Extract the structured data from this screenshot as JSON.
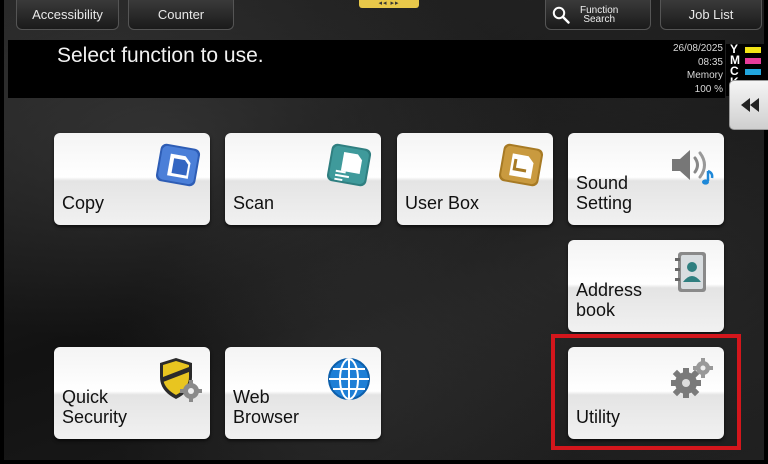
{
  "top_tabs": {
    "accessibility": "Accessibility",
    "counter": "Counter",
    "function_search_line1": "Function",
    "function_search_line2": "Search",
    "job_list": "Job List"
  },
  "message": "Select function to use.",
  "status": {
    "date": "26/08/2025",
    "time": "08:35",
    "memory_label": "Memory",
    "memory_value": "100 %"
  },
  "toner": [
    {
      "letter": "Y",
      "color": "#f2e416"
    },
    {
      "letter": "M",
      "color": "#e83c9b"
    },
    {
      "letter": "C",
      "color": "#22a6de"
    },
    {
      "letter": "K",
      "color": "#222222"
    }
  ],
  "tiles": {
    "copy": "Copy",
    "scan": "Scan",
    "user_box": "User Box",
    "sound_setting": "Sound\nSetting",
    "address_book": "Address\nbook",
    "quick_security": "Quick\nSecurity",
    "web_browser": "Web\nBrowser",
    "utility": "Utility"
  },
  "colors": {
    "highlight": "#d4161c",
    "copy_icon": "#2e5db5",
    "scan_icon": "#2f7f80",
    "user_box_icon": "#b7892e",
    "web_icon": "#1e7fd6"
  }
}
